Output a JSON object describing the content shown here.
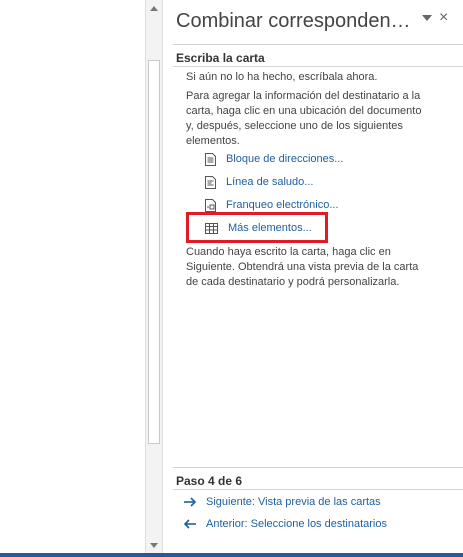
{
  "pane": {
    "title": "Combinar corresponden…",
    "menu_icon": "dropdown-triangle-icon",
    "close_label": "×"
  },
  "section": {
    "title": "Escriba la carta",
    "intro1": "Si aún no lo ha hecho, escríbala ahora.",
    "intro2": "Para agregar la información del destinatario a la carta, haga clic en una ubicación del documento y, después, seleccione uno de los siguientes elementos.",
    "links": [
      {
        "label": "Bloque de direcciones...",
        "icon": "address-block-icon"
      },
      {
        "label": "Línea de saludo...",
        "icon": "greeting-line-icon"
      },
      {
        "label": "Franqueo electrónico...",
        "icon": "electronic-postage-icon"
      },
      {
        "label": "Más elementos...",
        "icon": "more-items-icon"
      }
    ],
    "outro": "Cuando haya escrito la carta, haga clic en Siguiente. Obtendrá una vista previa de la carta de cada destinatario y podrá personalizarla."
  },
  "footer": {
    "step": "Paso 4 de 6",
    "next": "Siguiente: Vista previa de las cartas",
    "prev": "Anterior: Seleccione los destinatarios"
  },
  "colors": {
    "link": "#1f5f9f",
    "highlight": "#e01b24",
    "bottom_bar": "#2b5797"
  }
}
